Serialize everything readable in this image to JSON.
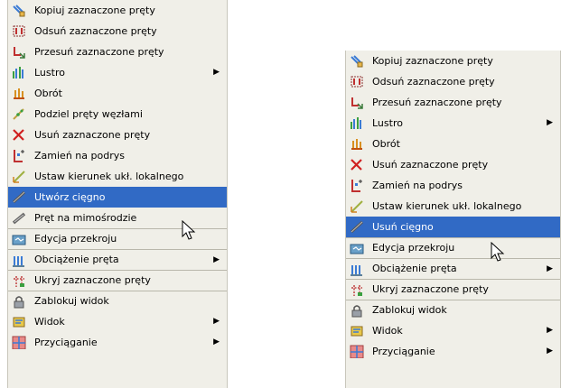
{
  "left_menu": {
    "items": [
      {
        "label": "Kopiuj zaznaczone pręty",
        "icon": "copy-bars-icon"
      },
      {
        "label": "Odsuń zaznaczone pręty",
        "icon": "offset-bars-icon"
      },
      {
        "label": "Przesuń zaznaczone pręty",
        "icon": "move-bars-icon"
      },
      {
        "label": "Lustro",
        "icon": "mirror-icon",
        "submenu_arrow": "▶"
      },
      {
        "label": "Obrót",
        "icon": "rotate-icon"
      },
      {
        "label": "Podziel pręty węzłami",
        "icon": "divide-bars-icon"
      },
      {
        "label": "Usuń zaznaczone pręty",
        "icon": "delete-bars-icon"
      },
      {
        "label": "Zamień na podrys",
        "icon": "convert-underlay-icon"
      },
      {
        "label": "Ustaw kierunek ukł. lokalnego",
        "icon": "local-axis-icon"
      },
      {
        "label": "Utwórz cięgno",
        "icon": "cable-icon",
        "highlighted": true
      },
      {
        "label": "Pręt na mimośrodzie",
        "icon": "eccentric-bar-icon"
      },
      {
        "label": "Edycja przekroju",
        "icon": "section-edit-icon",
        "separator": true
      },
      {
        "label": "Obciążenie pręta",
        "icon": "bar-load-icon",
        "submenu_arrow": "▶",
        "separator": true
      },
      {
        "label": "Ukryj zaznaczone pręty",
        "icon": "hide-bars-icon",
        "separator": true
      },
      {
        "label": "Zablokuj widok",
        "icon": "lock-icon",
        "separator": true
      },
      {
        "label": "Widok",
        "icon": "view-icon",
        "submenu_arrow": "▶"
      },
      {
        "label": "Przyciąganie",
        "icon": "snap-icon",
        "submenu_arrow": "▶"
      }
    ]
  },
  "right_menu": {
    "items": [
      {
        "label": "Kopiuj zaznaczone pręty",
        "icon": "copy-bars-icon"
      },
      {
        "label": "Odsuń zaznaczone pręty",
        "icon": "offset-bars-icon"
      },
      {
        "label": "Przesuń zaznaczone pręty",
        "icon": "move-bars-icon"
      },
      {
        "label": "Lustro",
        "icon": "mirror-icon",
        "submenu_arrow": "▶"
      },
      {
        "label": "Obrót",
        "icon": "rotate-icon"
      },
      {
        "label": "Usuń zaznaczone pręty",
        "icon": "delete-bars-icon"
      },
      {
        "label": "Zamień na podrys",
        "icon": "convert-underlay-icon"
      },
      {
        "label": "Ustaw kierunek ukł. lokalnego",
        "icon": "local-axis-icon"
      },
      {
        "label": "Usuń cięgno",
        "icon": "cable-icon",
        "highlighted": true
      },
      {
        "label": "Edycja przekroju",
        "icon": "section-edit-icon",
        "separator": true
      },
      {
        "label": "Obciążenie pręta",
        "icon": "bar-load-icon",
        "submenu_arrow": "▶",
        "separator": true
      },
      {
        "label": "Ukryj zaznaczone pręty",
        "icon": "hide-bars-icon",
        "separator": true
      },
      {
        "label": "Zablokuj widok",
        "icon": "lock-icon",
        "separator": true
      },
      {
        "label": "Widok",
        "icon": "view-icon",
        "submenu_arrow": "▶"
      },
      {
        "label": "Przyciąganie",
        "icon": "snap-icon",
        "submenu_arrow": "▶"
      }
    ]
  },
  "colors": {
    "menu_bg": "#f0efe8",
    "highlight": "#316ac5",
    "separator": "#b9b7ab"
  }
}
